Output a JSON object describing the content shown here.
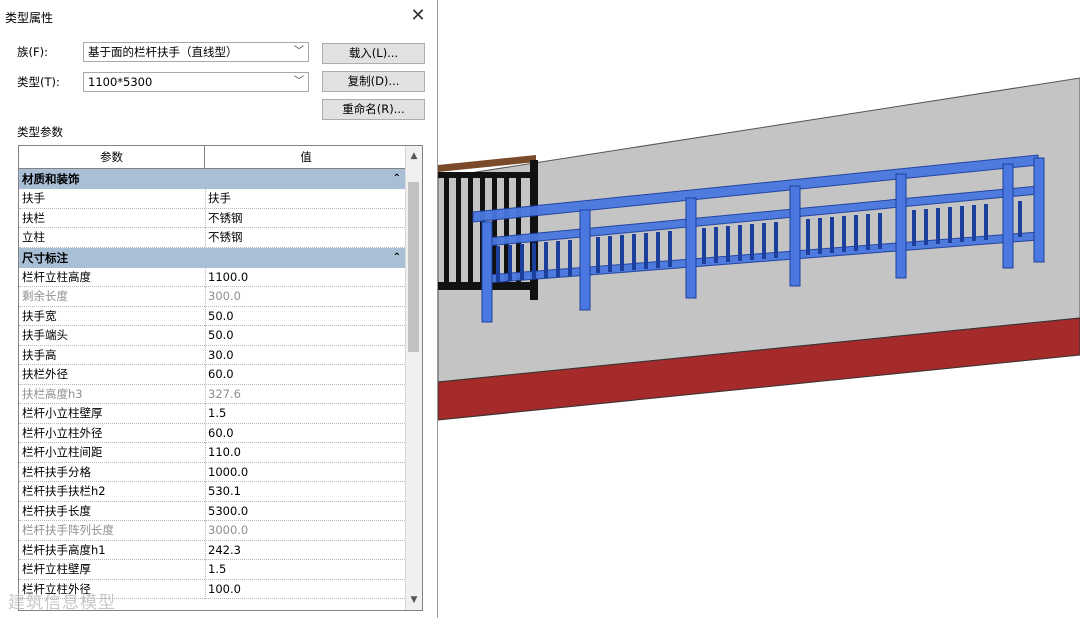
{
  "dialog": {
    "title": "类型属性",
    "family_label": "族(F):",
    "family_value": "基于面的栏杆扶手（直线型）",
    "type_label": "类型(T):",
    "type_value": "1100*5300",
    "load_button": "载入(L)...",
    "duplicate_button": "复制(D)...",
    "rename_button": "重命名(R)...",
    "section_label": "类型参数",
    "columns": {
      "param": "参数",
      "value": "值"
    },
    "groups": [
      {
        "name": "材质和装饰",
        "rows": [
          {
            "param": "扶手",
            "value": "扶手"
          },
          {
            "param": "扶栏",
            "value": "不锈钢"
          },
          {
            "param": "立柱",
            "value": "不锈钢"
          }
        ]
      },
      {
        "name": "尺寸标注",
        "rows": [
          {
            "param": "栏杆立柱高度",
            "value": "1100.0"
          },
          {
            "param": "剩余长度",
            "value": "300.0"
          },
          {
            "param": "扶手宽",
            "value": "50.0"
          },
          {
            "param": "扶手端头",
            "value": "50.0"
          },
          {
            "param": "扶手高",
            "value": "30.0"
          },
          {
            "param": "扶栏外径",
            "value": "60.0"
          },
          {
            "param": "扶栏高度h3",
            "value": "327.6"
          },
          {
            "param": "栏杆小立柱壁厚",
            "value": "1.5"
          },
          {
            "param": "栏杆小立柱外径",
            "value": "60.0"
          },
          {
            "param": "栏杆小立柱间距",
            "value": "110.0"
          },
          {
            "param": "栏杆扶手分格",
            "value": "1000.0"
          },
          {
            "param": "栏杆扶手扶栏h2",
            "value": "530.1"
          },
          {
            "param": "栏杆扶手长度",
            "value": "5300.0"
          },
          {
            "param": "栏杆扶手阵列长度",
            "value": "3000.0"
          },
          {
            "param": "栏杆扶手高度h1",
            "value": "242.3"
          },
          {
            "param": "栏杆立柱壁厚",
            "value": "1.5"
          },
          {
            "param": "栏杆立柱外径",
            "value": "100.0"
          }
        ]
      }
    ],
    "collapse_symbol": "⌃",
    "watermark": "建筑信息模型"
  },
  "colors": {
    "group_header": "#a9bfd6",
    "railing_blue": "#4a78e0",
    "slab_red": "#a52a2a",
    "slab_gray": "#c4c4c4"
  }
}
